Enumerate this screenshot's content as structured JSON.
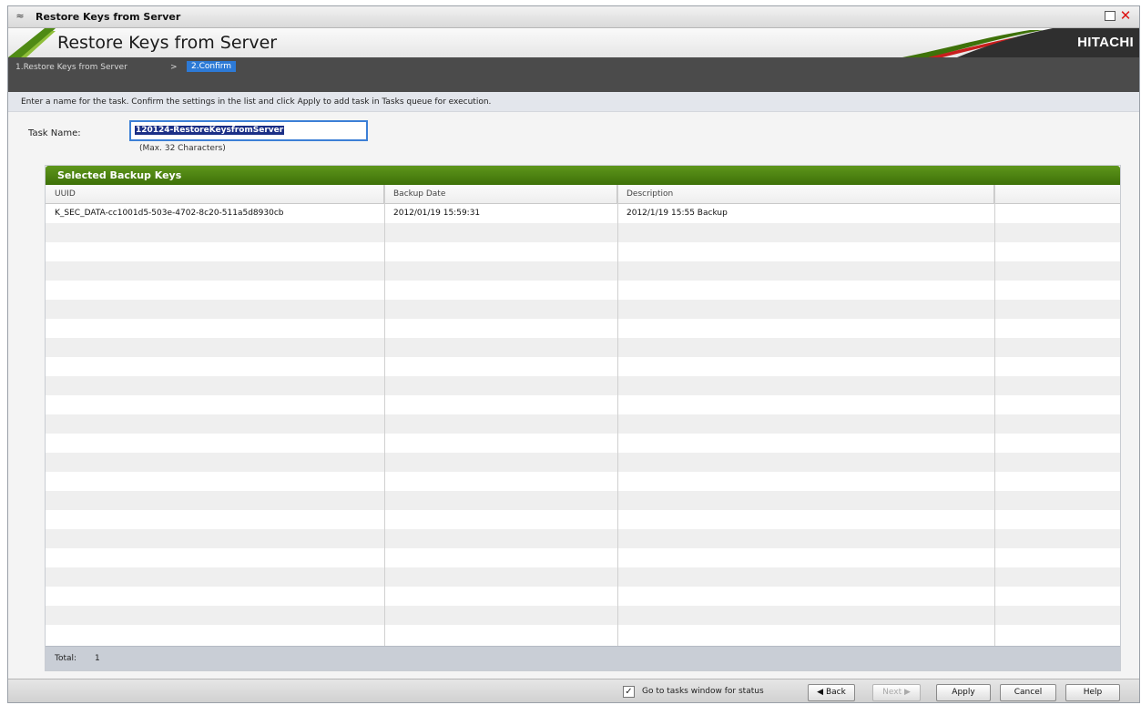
{
  "window": {
    "title": "Restore Keys from Server",
    "collapse_glyph": "≈",
    "max_icon": "maximize-icon",
    "close_glyph": "✕"
  },
  "banner": {
    "title": "Restore Keys from Server",
    "brand": "HITACHI",
    "accent_green": "#3e7109",
    "accent_red": "#c81e1e"
  },
  "breadcrumb": {
    "step1": "1.Restore Keys from Server",
    "separator": ">",
    "step2": "2.Confirm"
  },
  "instructions": "Enter a name for the task. Confirm the settings in the list and click Apply to add task in Tasks queue for execution.",
  "task": {
    "label": "Task Name:",
    "value": "120124-RestoreKeysfromServer",
    "hint": "(Max. 32 Characters)"
  },
  "table": {
    "title": "Selected Backup Keys",
    "columns": [
      "UUID",
      "Backup Date",
      "Description",
      ""
    ],
    "rows": [
      [
        "K_SEC_DATA-cc1001d5-503e-4702-8c20-511a5d8930cb",
        "2012/01/19 15:59:31",
        "2012/1/19 15:55 Backup",
        ""
      ]
    ],
    "total_label": "Total:",
    "total_value": "1"
  },
  "footer": {
    "checkbox_checked": true,
    "checkbox_label": "Go to tasks window for status",
    "back": "◀ Back",
    "next": "Next ▶",
    "apply": "Apply",
    "cancel": "Cancel",
    "help": "Help"
  }
}
